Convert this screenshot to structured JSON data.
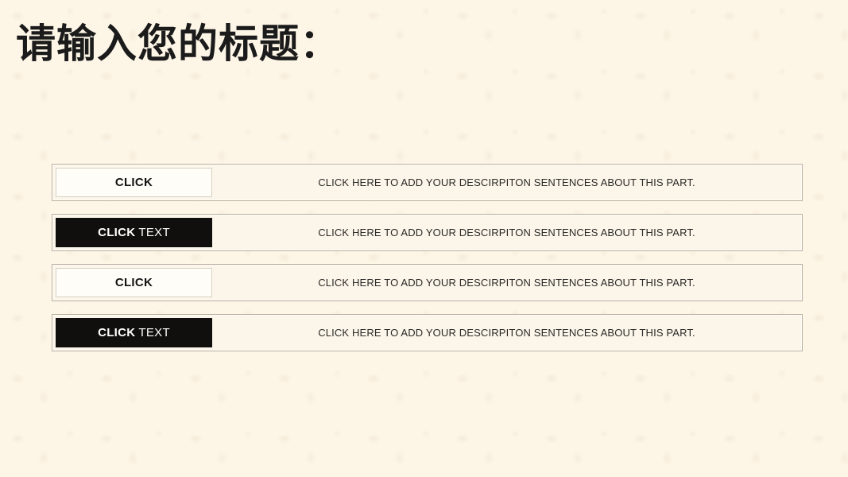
{
  "slide": {
    "title": "请输入您的标题：",
    "background_color": "#FDF5E6",
    "accent_dark": "#100F0E",
    "accent_light": "#FFFDF8",
    "border_color": "#B9B0A0"
  },
  "rows": [
    {
      "style": "light",
      "chip_strong": "CLICK",
      "chip_rest": "",
      "description": "CLICK HERE TO ADD YOUR DESCIRPITON SENTENCES ABOUT THIS PART."
    },
    {
      "style": "dark",
      "chip_strong": "CLICK",
      "chip_rest": "TEXT",
      "description": "CLICK HERE TO ADD YOUR DESCIRPITON SENTENCES ABOUT THIS PART."
    },
    {
      "style": "light",
      "chip_strong": "CLICK",
      "chip_rest": "",
      "description": "CLICK HERE TO ADD YOUR DESCIRPITON SENTENCES ABOUT THIS PART."
    },
    {
      "style": "dark",
      "chip_strong": "CLICK",
      "chip_rest": "TEXT",
      "description": "CLICK HERE TO ADD YOUR DESCIRPITON SENTENCES ABOUT THIS PART."
    }
  ]
}
